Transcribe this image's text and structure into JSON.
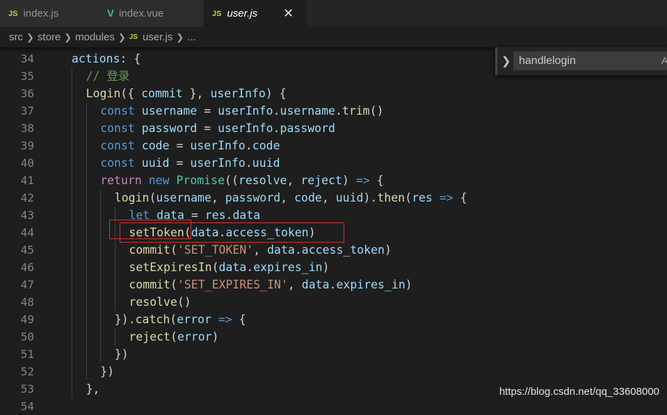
{
  "tabs": [
    {
      "icon": "JS",
      "label": "index.js"
    },
    {
      "icon": "V",
      "label": "index.vue"
    },
    {
      "icon": "JS",
      "label": "user.js",
      "close": "✕"
    }
  ],
  "breadcrumb": {
    "parts": [
      "src",
      "store",
      "modules",
      "user.js",
      "..."
    ],
    "file_icon": "JS"
  },
  "find_widget": {
    "value": "handlelogin",
    "option_label": "A"
  },
  "lines": [
    {
      "n": "34",
      "indent": 0,
      "tokens": [
        {
          "t": "actions",
          "c": "vr"
        },
        {
          "t": ": {",
          "c": "p"
        }
      ]
    },
    {
      "n": "35",
      "indent": 1,
      "tokens": [
        {
          "t": "// 登录",
          "c": "cm"
        }
      ]
    },
    {
      "n": "36",
      "indent": 1,
      "tokens": [
        {
          "t": "Login",
          "c": "fn"
        },
        {
          "t": "({ ",
          "c": "p"
        },
        {
          "t": "commit",
          "c": "vr"
        },
        {
          "t": " }, ",
          "c": "p"
        },
        {
          "t": "userInfo",
          "c": "vr"
        },
        {
          "t": ") {",
          "c": "p"
        }
      ]
    },
    {
      "n": "37",
      "indent": 2,
      "tokens": [
        {
          "t": "const ",
          "c": "kw"
        },
        {
          "t": "username",
          "c": "vr"
        },
        {
          "t": " = ",
          "c": "p"
        },
        {
          "t": "userInfo",
          "c": "vr"
        },
        {
          "t": ".",
          "c": "p"
        },
        {
          "t": "username",
          "c": "vr"
        },
        {
          "t": ".",
          "c": "p"
        },
        {
          "t": "trim",
          "c": "fn"
        },
        {
          "t": "()",
          "c": "p"
        }
      ]
    },
    {
      "n": "38",
      "indent": 2,
      "tokens": [
        {
          "t": "const ",
          "c": "kw"
        },
        {
          "t": "password",
          "c": "vr"
        },
        {
          "t": " = ",
          "c": "p"
        },
        {
          "t": "userInfo",
          "c": "vr"
        },
        {
          "t": ".",
          "c": "p"
        },
        {
          "t": "password",
          "c": "vr"
        }
      ]
    },
    {
      "n": "39",
      "indent": 2,
      "tokens": [
        {
          "t": "const ",
          "c": "kw"
        },
        {
          "t": "code",
          "c": "vr"
        },
        {
          "t": " = ",
          "c": "p"
        },
        {
          "t": "userInfo",
          "c": "vr"
        },
        {
          "t": ".",
          "c": "p"
        },
        {
          "t": "code",
          "c": "vr"
        }
      ]
    },
    {
      "n": "40",
      "indent": 2,
      "tokens": [
        {
          "t": "const ",
          "c": "kw"
        },
        {
          "t": "uuid",
          "c": "vr"
        },
        {
          "t": " = ",
          "c": "p"
        },
        {
          "t": "userInfo",
          "c": "vr"
        },
        {
          "t": ".",
          "c": "p"
        },
        {
          "t": "uuid",
          "c": "vr"
        }
      ]
    },
    {
      "n": "41",
      "indent": 2,
      "tokens": [
        {
          "t": "return ",
          "c": "cf"
        },
        {
          "t": "new ",
          "c": "kw"
        },
        {
          "t": "Promise",
          "c": "cl"
        },
        {
          "t": "((",
          "c": "p"
        },
        {
          "t": "resolve",
          "c": "vr"
        },
        {
          "t": ", ",
          "c": "p"
        },
        {
          "t": "reject",
          "c": "vr"
        },
        {
          "t": ") ",
          "c": "p"
        },
        {
          "t": "=>",
          "c": "kw"
        },
        {
          "t": " {",
          "c": "p"
        }
      ]
    },
    {
      "n": "42",
      "indent": 3,
      "tokens": [
        {
          "t": "login",
          "c": "fn"
        },
        {
          "t": "(",
          "c": "p"
        },
        {
          "t": "username",
          "c": "vr"
        },
        {
          "t": ", ",
          "c": "p"
        },
        {
          "t": "password",
          "c": "vr"
        },
        {
          "t": ", ",
          "c": "p"
        },
        {
          "t": "code",
          "c": "vr"
        },
        {
          "t": ", ",
          "c": "p"
        },
        {
          "t": "uuid",
          "c": "vr"
        },
        {
          "t": ").",
          "c": "p"
        },
        {
          "t": "then",
          "c": "fn"
        },
        {
          "t": "(",
          "c": "p"
        },
        {
          "t": "res",
          "c": "vr"
        },
        {
          "t": " ",
          "c": "p"
        },
        {
          "t": "=>",
          "c": "kw"
        },
        {
          "t": " {",
          "c": "p"
        }
      ]
    },
    {
      "n": "43",
      "indent": 4,
      "tokens": [
        {
          "t": "let ",
          "c": "kw"
        },
        {
          "t": "data",
          "c": "vr"
        },
        {
          "t": " = ",
          "c": "p"
        },
        {
          "t": "res",
          "c": "vr"
        },
        {
          "t": ".",
          "c": "p"
        },
        {
          "t": "data",
          "c": "vr"
        }
      ]
    },
    {
      "n": "44",
      "indent": 4,
      "tokens": [
        {
          "t": "setToken",
          "c": "fn"
        },
        {
          "t": "(",
          "c": "p"
        },
        {
          "t": "data",
          "c": "vr"
        },
        {
          "t": ".",
          "c": "p"
        },
        {
          "t": "access_token",
          "c": "vr"
        },
        {
          "t": ")",
          "c": "p"
        }
      ]
    },
    {
      "n": "45",
      "indent": 4,
      "tokens": [
        {
          "t": "commit",
          "c": "fn"
        },
        {
          "t": "(",
          "c": "p"
        },
        {
          "t": "'SET_TOKEN'",
          "c": "st"
        },
        {
          "t": ", ",
          "c": "p"
        },
        {
          "t": "data",
          "c": "vr"
        },
        {
          "t": ".",
          "c": "p"
        },
        {
          "t": "access_token",
          "c": "vr"
        },
        {
          "t": ")",
          "c": "p"
        }
      ]
    },
    {
      "n": "46",
      "indent": 4,
      "tokens": [
        {
          "t": "setExpiresIn",
          "c": "fn"
        },
        {
          "t": "(",
          "c": "p"
        },
        {
          "t": "data",
          "c": "vr"
        },
        {
          "t": ".",
          "c": "p"
        },
        {
          "t": "expires_in",
          "c": "vr"
        },
        {
          "t": ")",
          "c": "p"
        }
      ]
    },
    {
      "n": "47",
      "indent": 4,
      "tokens": [
        {
          "t": "commit",
          "c": "fn"
        },
        {
          "t": "(",
          "c": "p"
        },
        {
          "t": "'SET_EXPIRES_IN'",
          "c": "st"
        },
        {
          "t": ", ",
          "c": "p"
        },
        {
          "t": "data",
          "c": "vr"
        },
        {
          "t": ".",
          "c": "p"
        },
        {
          "t": "expires_in",
          "c": "vr"
        },
        {
          "t": ")",
          "c": "p"
        }
      ]
    },
    {
      "n": "48",
      "indent": 4,
      "tokens": [
        {
          "t": "resolve",
          "c": "fn"
        },
        {
          "t": "()",
          "c": "p"
        }
      ]
    },
    {
      "n": "49",
      "indent": 3,
      "tokens": [
        {
          "t": "}).",
          "c": "p"
        },
        {
          "t": "catch",
          "c": "fn"
        },
        {
          "t": "(",
          "c": "p"
        },
        {
          "t": "error",
          "c": "vr"
        },
        {
          "t": " ",
          "c": "p"
        },
        {
          "t": "=>",
          "c": "kw"
        },
        {
          "t": " {",
          "c": "p"
        }
      ]
    },
    {
      "n": "50",
      "indent": 4,
      "tokens": [
        {
          "t": "reject",
          "c": "fn"
        },
        {
          "t": "(",
          "c": "p"
        },
        {
          "t": "error",
          "c": "vr"
        },
        {
          "t": ")",
          "c": "p"
        }
      ]
    },
    {
      "n": "51",
      "indent": 3,
      "tokens": [
        {
          "t": "})",
          "c": "p"
        }
      ]
    },
    {
      "n": "52",
      "indent": 2,
      "tokens": [
        {
          "t": "})",
          "c": "p"
        }
      ]
    },
    {
      "n": "53",
      "indent": 1,
      "tokens": [
        {
          "t": "},",
          "c": "p"
        }
      ]
    },
    {
      "n": "54",
      "indent": 0,
      "tokens": []
    }
  ],
  "highlight_line": "44",
  "watermark": "https://blog.csdn.net/qq_33608000"
}
